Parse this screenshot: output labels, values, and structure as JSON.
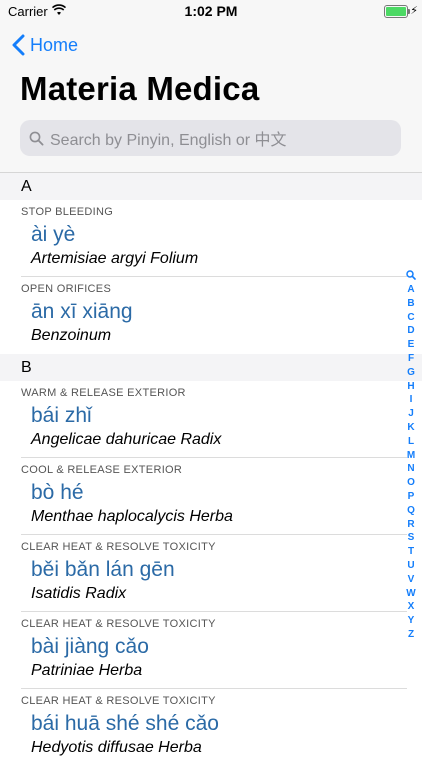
{
  "status": {
    "carrier": "Carrier",
    "time": "1:02 PM"
  },
  "nav": {
    "back_label": "Home",
    "title": "Materia Medica"
  },
  "search": {
    "placeholder": "Search by Pinyin, English or 中文"
  },
  "sections": [
    {
      "letter": "A",
      "items": [
        {
          "category": "STOP BLEEDING",
          "pinyin": "ài yè",
          "latin": "Artemisiae argyi Folium"
        },
        {
          "category": "OPEN ORIFICES",
          "pinyin": "ān xī xiāng",
          "latin": "Benzoinum"
        }
      ]
    },
    {
      "letter": "B",
      "items": [
        {
          "category": "WARM & RELEASE EXTERIOR",
          "pinyin": "bái zhǐ",
          "latin": "Angelicae dahuricae Radix"
        },
        {
          "category": "COOL & RELEASE EXTERIOR",
          "pinyin": "bò hé",
          "latin": "Menthae haplocalycis Herba"
        },
        {
          "category": "CLEAR HEAT & RESOLVE TOXICITY",
          "pinyin": "běi bǎn lán gēn",
          "latin": "Isatidis Radix"
        },
        {
          "category": "CLEAR HEAT & RESOLVE TOXICITY",
          "pinyin": "bài jiàng cǎo",
          "latin": "Patriniae Herba"
        },
        {
          "category": "CLEAR HEAT & RESOLVE TOXICITY",
          "pinyin": "bái huā shé shé cǎo",
          "latin": "Hedyotis diffusae Herba"
        }
      ]
    }
  ],
  "index_letters": [
    "A",
    "B",
    "C",
    "D",
    "E",
    "F",
    "G",
    "H",
    "I",
    "J",
    "K",
    "L",
    "M",
    "N",
    "O",
    "P",
    "Q",
    "R",
    "S",
    "T",
    "U",
    "V",
    "W",
    "X",
    "Y",
    "Z"
  ],
  "colors": {
    "accent": "#147efb",
    "pinyin": "#2b6aa6"
  }
}
